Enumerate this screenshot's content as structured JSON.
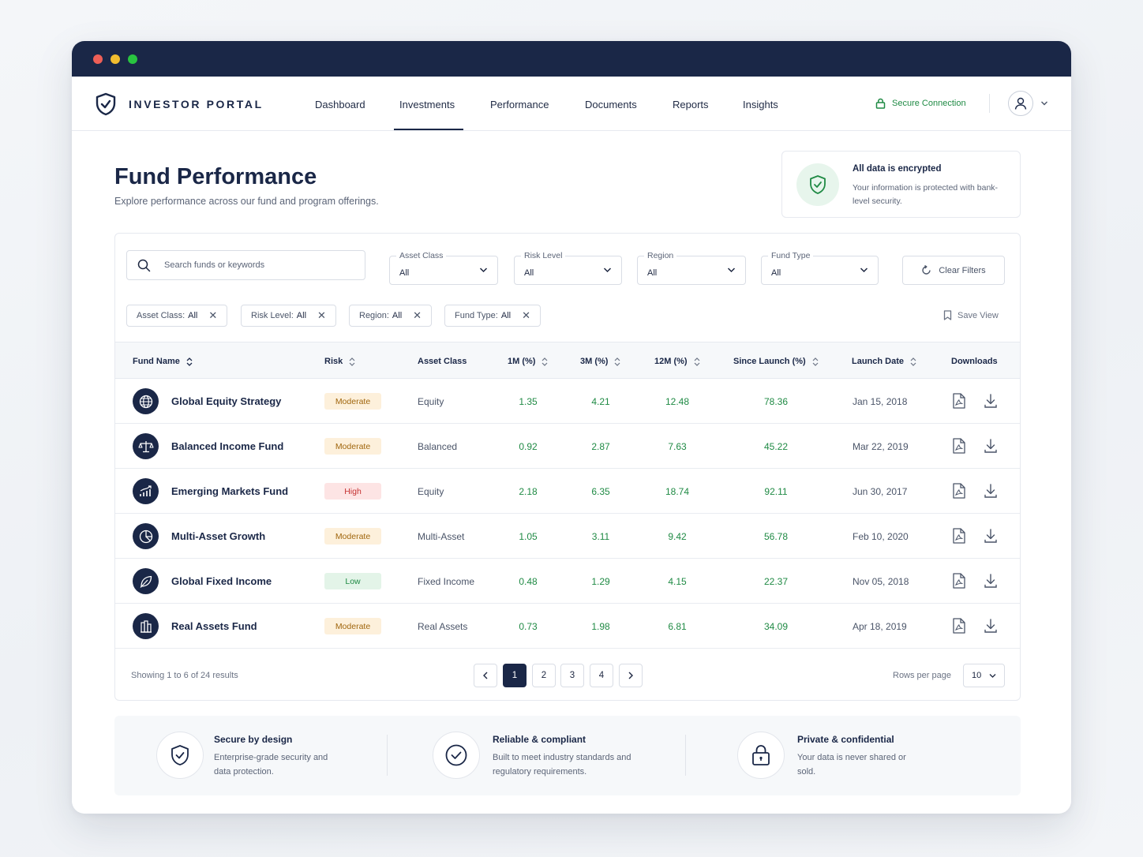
{
  "brand": {
    "name": "INVESTOR PORTAL"
  },
  "nav": {
    "items": [
      "Dashboard",
      "Investments",
      "Performance",
      "Documents",
      "Reports",
      "Insights"
    ],
    "active": "Investments",
    "secure_label": "Secure Connection"
  },
  "header": {
    "title": "Fund Performance",
    "subtitle": "Explore performance across our fund and program offerings."
  },
  "encryption": {
    "title": "All data is encrypted",
    "text": "Your information is protected with bank-level security."
  },
  "filters": {
    "search_placeholder": "Search funds or keywords",
    "selects": [
      {
        "label": "Asset Class",
        "value": "All"
      },
      {
        "label": "Risk Level",
        "value": "All"
      },
      {
        "label": "Region",
        "value": "All"
      },
      {
        "label": "Fund Type",
        "value": "All"
      }
    ],
    "clear_label": "Clear Filters",
    "chips": [
      {
        "label": "Asset Class:",
        "value": "All"
      },
      {
        "label": "Risk Level:",
        "value": "All"
      },
      {
        "label": "Region:",
        "value": "All"
      },
      {
        "label": "Fund Type:",
        "value": "All"
      }
    ],
    "save_view_label": "Save View"
  },
  "table": {
    "headers": [
      "Fund Name",
      "Risk",
      "Asset Class",
      "1M (%)",
      "3M (%)",
      "12M (%)",
      "Since Launch (%)",
      "Launch Date",
      "Downloads"
    ],
    "rows": [
      {
        "icon": "globe-icon",
        "name": "Global Equity Strategy",
        "risk": "Moderate",
        "asset_class": "Equity",
        "m1": "1.35",
        "m3": "4.21",
        "m12": "12.48",
        "since": "78.36",
        "date": "Jan 15, 2018"
      },
      {
        "icon": "scales-icon",
        "name": "Balanced Income Fund",
        "risk": "Moderate",
        "asset_class": "Balanced",
        "m1": "0.92",
        "m3": "2.87",
        "m12": "7.63",
        "since": "45.22",
        "date": "Mar 22, 2019"
      },
      {
        "icon": "growth-chart-icon",
        "name": "Emerging Markets Fund",
        "risk": "High",
        "asset_class": "Equity",
        "m1": "2.18",
        "m3": "6.35",
        "m12": "18.74",
        "since": "92.11",
        "date": "Jun 30, 2017"
      },
      {
        "icon": "pie-chart-icon",
        "name": "Multi-Asset Growth",
        "risk": "Moderate",
        "asset_class": "Multi-Asset",
        "m1": "1.05",
        "m3": "3.11",
        "m12": "9.42",
        "since": "56.78",
        "date": "Feb 10, 2020"
      },
      {
        "icon": "leaf-icon",
        "name": "Global Fixed Income",
        "risk": "Low",
        "asset_class": "Fixed Income",
        "m1": "0.48",
        "m3": "1.29",
        "m12": "4.15",
        "since": "22.37",
        "date": "Nov 05, 2018"
      },
      {
        "icon": "building-icon",
        "name": "Real Assets Fund",
        "risk": "Moderate",
        "asset_class": "Real Assets",
        "m1": "0.73",
        "m3": "1.98",
        "m12": "6.81",
        "since": "34.09",
        "date": "Apr 18, 2019"
      }
    ]
  },
  "pagination": {
    "showing": "Showing 1 to 6 of 24 results",
    "pages": [
      "1",
      "2",
      "3",
      "4"
    ],
    "current": "1",
    "rows_label": "Rows per page",
    "rows_value": "10"
  },
  "features": [
    {
      "icon": "shield-check-icon",
      "title": "Secure by design",
      "text": "Enterprise-grade security and data protection."
    },
    {
      "icon": "check-circle-icon",
      "title": "Reliable & compliant",
      "text": "Built to meet industry standards and regulatory requirements."
    },
    {
      "icon": "lock-icon",
      "title": "Private & confidential",
      "text": "Your data is never shared or sold."
    }
  ],
  "colors": {
    "navy": "#1a2747",
    "positive": "#1f8a44",
    "moderate_bg": "#fdf0db",
    "high_bg": "#fde4e4",
    "low_bg": "#e3f4e8"
  }
}
